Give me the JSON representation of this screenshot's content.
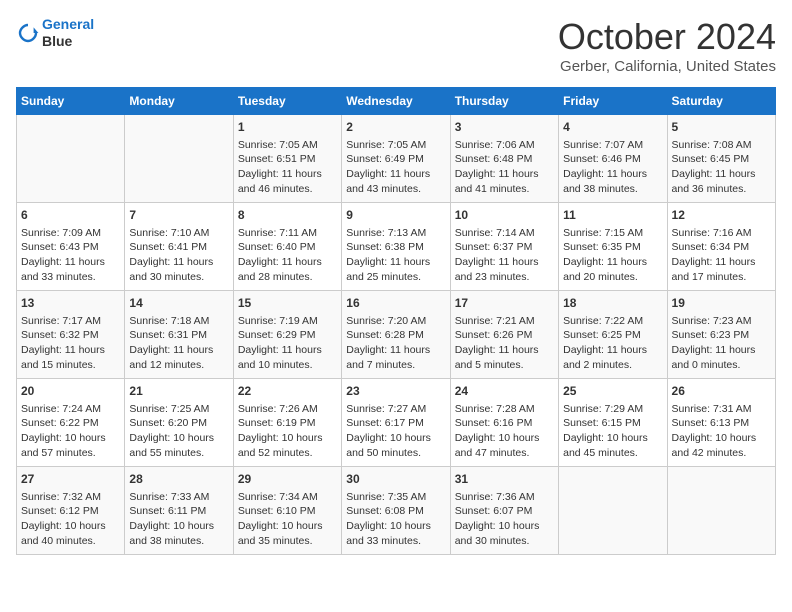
{
  "header": {
    "logo_line1": "General",
    "logo_line2": "Blue",
    "month": "October 2024",
    "location": "Gerber, California, United States"
  },
  "days_of_week": [
    "Sunday",
    "Monday",
    "Tuesday",
    "Wednesday",
    "Thursday",
    "Friday",
    "Saturday"
  ],
  "weeks": [
    [
      {
        "day": "",
        "info": ""
      },
      {
        "day": "",
        "info": ""
      },
      {
        "day": "1",
        "info": "Sunrise: 7:05 AM\nSunset: 6:51 PM\nDaylight: 11 hours and 46 minutes."
      },
      {
        "day": "2",
        "info": "Sunrise: 7:05 AM\nSunset: 6:49 PM\nDaylight: 11 hours and 43 minutes."
      },
      {
        "day": "3",
        "info": "Sunrise: 7:06 AM\nSunset: 6:48 PM\nDaylight: 11 hours and 41 minutes."
      },
      {
        "day": "4",
        "info": "Sunrise: 7:07 AM\nSunset: 6:46 PM\nDaylight: 11 hours and 38 minutes."
      },
      {
        "day": "5",
        "info": "Sunrise: 7:08 AM\nSunset: 6:45 PM\nDaylight: 11 hours and 36 minutes."
      }
    ],
    [
      {
        "day": "6",
        "info": "Sunrise: 7:09 AM\nSunset: 6:43 PM\nDaylight: 11 hours and 33 minutes."
      },
      {
        "day": "7",
        "info": "Sunrise: 7:10 AM\nSunset: 6:41 PM\nDaylight: 11 hours and 30 minutes."
      },
      {
        "day": "8",
        "info": "Sunrise: 7:11 AM\nSunset: 6:40 PM\nDaylight: 11 hours and 28 minutes."
      },
      {
        "day": "9",
        "info": "Sunrise: 7:13 AM\nSunset: 6:38 PM\nDaylight: 11 hours and 25 minutes."
      },
      {
        "day": "10",
        "info": "Sunrise: 7:14 AM\nSunset: 6:37 PM\nDaylight: 11 hours and 23 minutes."
      },
      {
        "day": "11",
        "info": "Sunrise: 7:15 AM\nSunset: 6:35 PM\nDaylight: 11 hours and 20 minutes."
      },
      {
        "day": "12",
        "info": "Sunrise: 7:16 AM\nSunset: 6:34 PM\nDaylight: 11 hours and 17 minutes."
      }
    ],
    [
      {
        "day": "13",
        "info": "Sunrise: 7:17 AM\nSunset: 6:32 PM\nDaylight: 11 hours and 15 minutes."
      },
      {
        "day": "14",
        "info": "Sunrise: 7:18 AM\nSunset: 6:31 PM\nDaylight: 11 hours and 12 minutes."
      },
      {
        "day": "15",
        "info": "Sunrise: 7:19 AM\nSunset: 6:29 PM\nDaylight: 11 hours and 10 minutes."
      },
      {
        "day": "16",
        "info": "Sunrise: 7:20 AM\nSunset: 6:28 PM\nDaylight: 11 hours and 7 minutes."
      },
      {
        "day": "17",
        "info": "Sunrise: 7:21 AM\nSunset: 6:26 PM\nDaylight: 11 hours and 5 minutes."
      },
      {
        "day": "18",
        "info": "Sunrise: 7:22 AM\nSunset: 6:25 PM\nDaylight: 11 hours and 2 minutes."
      },
      {
        "day": "19",
        "info": "Sunrise: 7:23 AM\nSunset: 6:23 PM\nDaylight: 11 hours and 0 minutes."
      }
    ],
    [
      {
        "day": "20",
        "info": "Sunrise: 7:24 AM\nSunset: 6:22 PM\nDaylight: 10 hours and 57 minutes."
      },
      {
        "day": "21",
        "info": "Sunrise: 7:25 AM\nSunset: 6:20 PM\nDaylight: 10 hours and 55 minutes."
      },
      {
        "day": "22",
        "info": "Sunrise: 7:26 AM\nSunset: 6:19 PM\nDaylight: 10 hours and 52 minutes."
      },
      {
        "day": "23",
        "info": "Sunrise: 7:27 AM\nSunset: 6:17 PM\nDaylight: 10 hours and 50 minutes."
      },
      {
        "day": "24",
        "info": "Sunrise: 7:28 AM\nSunset: 6:16 PM\nDaylight: 10 hours and 47 minutes."
      },
      {
        "day": "25",
        "info": "Sunrise: 7:29 AM\nSunset: 6:15 PM\nDaylight: 10 hours and 45 minutes."
      },
      {
        "day": "26",
        "info": "Sunrise: 7:31 AM\nSunset: 6:13 PM\nDaylight: 10 hours and 42 minutes."
      }
    ],
    [
      {
        "day": "27",
        "info": "Sunrise: 7:32 AM\nSunset: 6:12 PM\nDaylight: 10 hours and 40 minutes."
      },
      {
        "day": "28",
        "info": "Sunrise: 7:33 AM\nSunset: 6:11 PM\nDaylight: 10 hours and 38 minutes."
      },
      {
        "day": "29",
        "info": "Sunrise: 7:34 AM\nSunset: 6:10 PM\nDaylight: 10 hours and 35 minutes."
      },
      {
        "day": "30",
        "info": "Sunrise: 7:35 AM\nSunset: 6:08 PM\nDaylight: 10 hours and 33 minutes."
      },
      {
        "day": "31",
        "info": "Sunrise: 7:36 AM\nSunset: 6:07 PM\nDaylight: 10 hours and 30 minutes."
      },
      {
        "day": "",
        "info": ""
      },
      {
        "day": "",
        "info": ""
      }
    ]
  ]
}
